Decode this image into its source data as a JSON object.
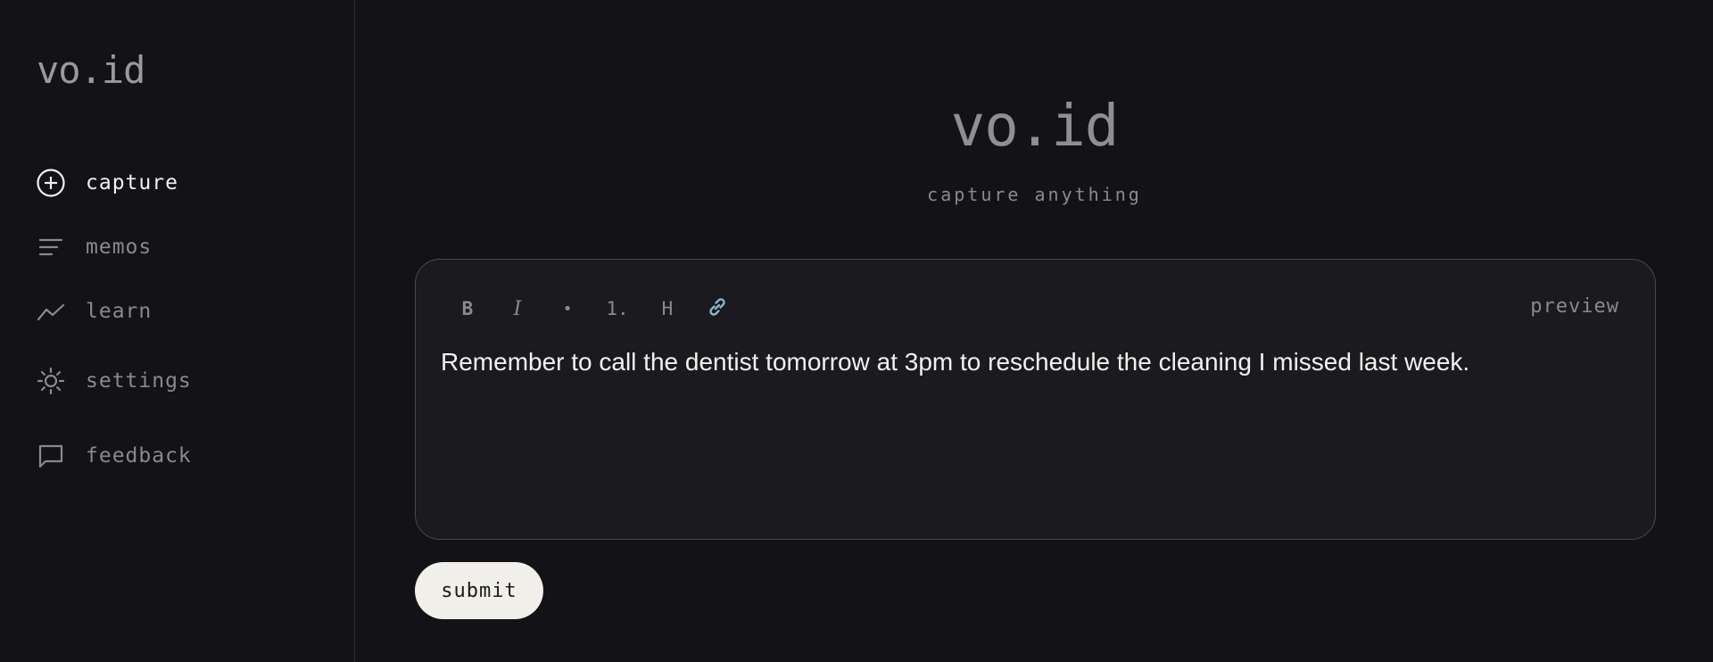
{
  "sidebar": {
    "logo": "vo.id",
    "items": [
      {
        "label": "capture",
        "icon": "plus-circle-icon",
        "active": true
      },
      {
        "label": "memos",
        "icon": "lines-icon"
      },
      {
        "label": "learn",
        "icon": "trend-line-icon"
      },
      {
        "label": "settings",
        "icon": "sun-icon"
      },
      {
        "label": "feedback",
        "icon": "message-square-icon"
      }
    ]
  },
  "main": {
    "title": "vo.id",
    "subtitle": "capture anything",
    "editor": {
      "toolbar": {
        "bold": "B",
        "italic": "I",
        "bullet": "•",
        "ordered": "1.",
        "heading": "H",
        "link_icon": "link-icon"
      },
      "preview_label": "preview",
      "content": "Remember to call the dentist tomorrow at 3pm to reschedule the cleaning I missed last week."
    },
    "submit_label": "submit"
  },
  "colors": {
    "background": "#131217",
    "editor_bg": "#1b1a1f",
    "text_primary": "#f2f1ee",
    "text_muted": "#8a8990",
    "link_accent": "#8fb3c9",
    "submit_bg": "#f1efe9"
  }
}
